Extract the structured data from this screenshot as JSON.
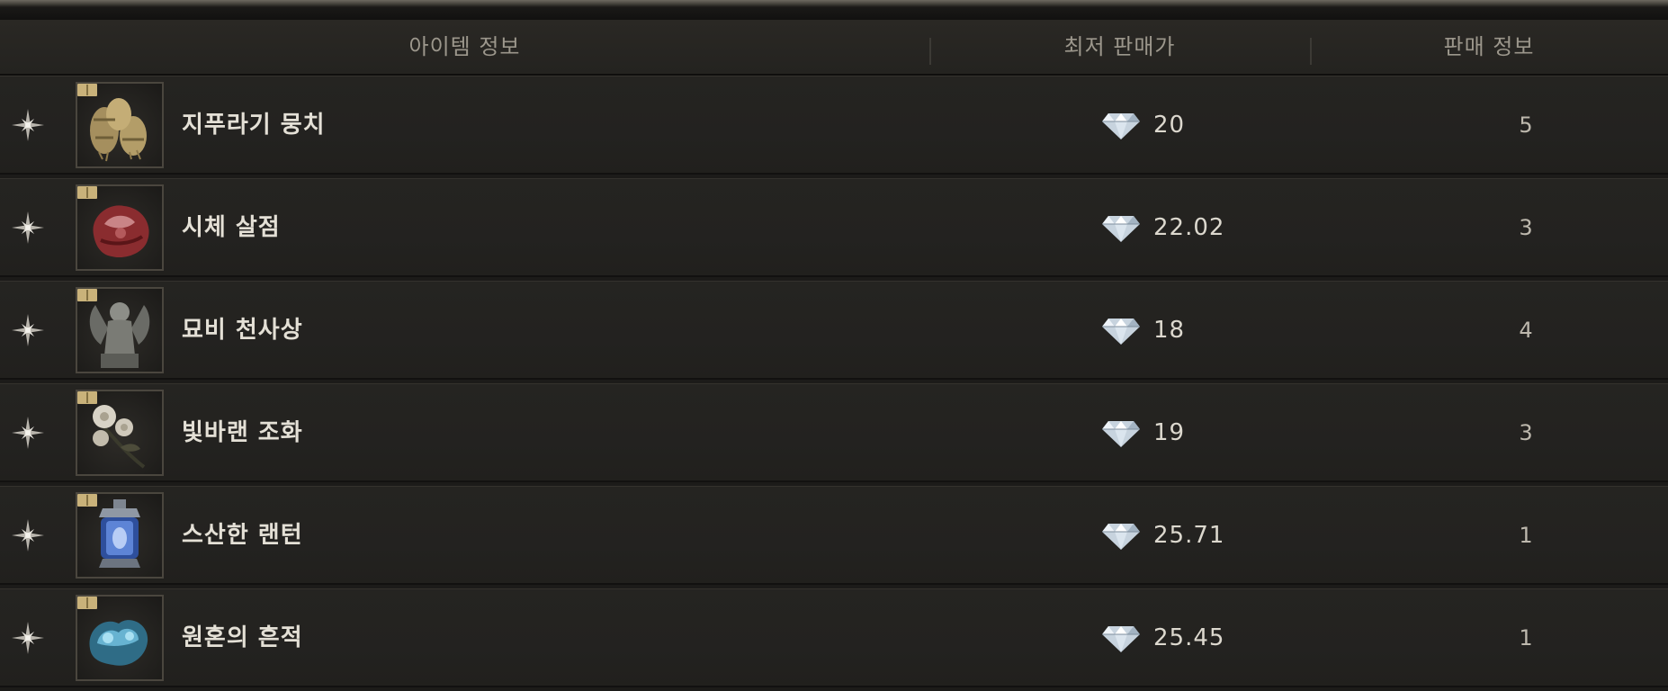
{
  "header": {
    "item_info": "아이템 정보",
    "lowest_price": "최저 판매가",
    "sale_info": "판매 정보"
  },
  "icons": {
    "favorite": "star-sparkle-icon",
    "currency": "diamond-gem-icon",
    "badge": "book-icon"
  },
  "colors": {
    "text": "#e4e0d6",
    "header_text": "#9c978c",
    "row_bg": "#232220",
    "slot_border": "#4a463e"
  },
  "rows": [
    {
      "name": "지푸라기 뭉치",
      "price": "20",
      "sales": "5",
      "icon": "straw-bundle-icon"
    },
    {
      "name": "시체 살점",
      "price": "22.02",
      "sales": "3",
      "icon": "flesh-chunk-icon"
    },
    {
      "name": "묘비 천사상",
      "price": "18",
      "sales": "4",
      "icon": "angel-statue-icon"
    },
    {
      "name": "빛바랜 조화",
      "price": "19",
      "sales": "3",
      "icon": "faded-flower-icon"
    },
    {
      "name": "스산한 랜턴",
      "price": "25.71",
      "sales": "1",
      "icon": "eerie-lantern-icon"
    },
    {
      "name": "원혼의 흔적",
      "price": "25.45",
      "sales": "1",
      "icon": "spirit-trace-icon"
    }
  ]
}
